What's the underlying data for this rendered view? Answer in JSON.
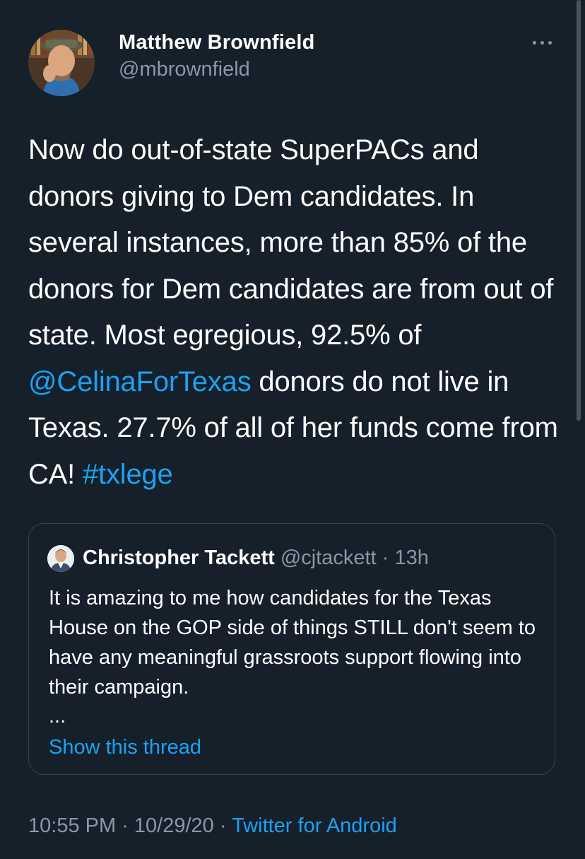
{
  "author": {
    "display_name": "Matthew Brownfield",
    "handle": "@mbrownfield"
  },
  "tweet": {
    "text_part1": "Now do out-of-state SuperPACs and donors giving to Dem candidates. In several instances, more than 85% of the donors for Dem candidates are from out of state. Most egregious, 92.5% of ",
    "mention": "@CelinaForTexas",
    "text_part2": " donors do not live in Texas. 27.7% of all of her funds come from CA! ",
    "hashtag": "#txlege"
  },
  "quoted_tweet": {
    "display_name": "Christopher Tackett",
    "handle": "@cjtackett",
    "separator": " · ",
    "time_ago": "13h",
    "text": "It is amazing to me how candidates for the Texas House on the GOP side of things STILL don't seem to have any meaningful grassroots support flowing into their campaign.",
    "ellipsis": "...",
    "show_thread_label": "Show this thread"
  },
  "meta": {
    "time": "10:55 PM",
    "separator": " · ",
    "date": "10/29/20",
    "source": "Twitter for Android"
  },
  "colors": {
    "background": "#15202b",
    "accent": "#1da1f2",
    "secondary_text": "#8899a6",
    "border": "#38444d"
  },
  "icons": {
    "more": "more-horizontal-icon"
  }
}
